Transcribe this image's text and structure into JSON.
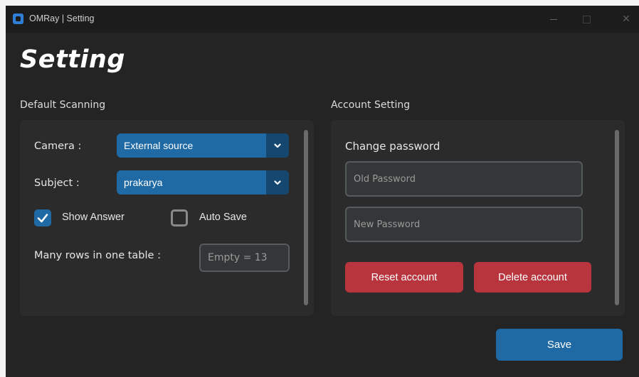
{
  "window": {
    "title": "OMRay | Setting",
    "controls": {
      "minimize": "minimize",
      "maximize": "maximize",
      "close": "✕"
    }
  },
  "page": {
    "title": "Setting"
  },
  "default_scanning": {
    "section_label": "Default Scanning",
    "camera": {
      "label": "Camera :",
      "value": "External source"
    },
    "subject": {
      "label": "Subject :",
      "value": "prakarya"
    },
    "show_answer": {
      "label": "Show Answer",
      "checked": true
    },
    "auto_save": {
      "label": "Auto Save",
      "checked": false
    },
    "rows": {
      "label": "Many rows in one table :",
      "placeholder": "Empty = 13"
    }
  },
  "account_setting": {
    "section_label": "Account Setting",
    "change_password_label": "Change password",
    "old_password_placeholder": "Old Password",
    "new_password_placeholder": "New Password",
    "reset_label": "Reset account",
    "delete_label": "Delete account"
  },
  "save_label": "Save",
  "colors": {
    "accent": "#1f6aa5",
    "accent_dark": "#144870",
    "danger": "#b8353d",
    "background": "#242424",
    "panel": "#2b2b2b"
  }
}
